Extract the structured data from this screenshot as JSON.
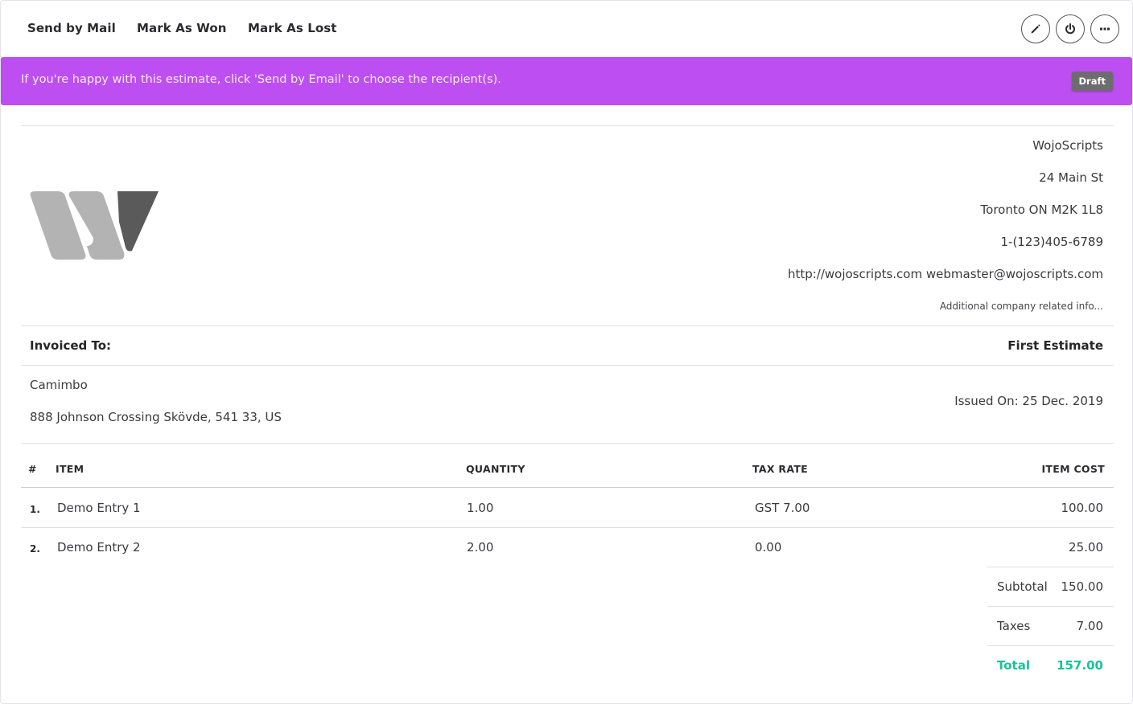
{
  "toolbar": {
    "send_mail": "Send by Mail",
    "mark_won": "Mark As Won",
    "mark_lost": "Mark As Lost",
    "icons": [
      "pencil-icon",
      "power-icon",
      "more-icon"
    ]
  },
  "banner": {
    "message": "If you're happy with this estimate, click 'Send by Email' to choose the recipient(s).",
    "status": "Draft",
    "color": "#bd4ff2"
  },
  "company": {
    "name": "WojoScripts",
    "street": "24 Main St",
    "city": "Toronto ON M2K 1L8",
    "phone": "1-(123)405-6789",
    "web_email": "http://wojoscripts.com webmaster@wojoscripts.com",
    "extra": "Additional company related info..."
  },
  "invoice": {
    "invoiced_to_label": "Invoiced To:",
    "title": "First Estimate",
    "client_name": "Camimbo",
    "client_address": "888 Johnson Crossing Skövde, 541 33, US",
    "issued": "Issued On: 25 Dec. 2019"
  },
  "table": {
    "headers": {
      "num": "#",
      "item": "ITEM",
      "quantity": "QUANTITY",
      "tax": "TAX RATE",
      "cost": "ITEM COST"
    },
    "rows": [
      {
        "num": "1.",
        "item": "Demo Entry 1",
        "quantity": "1.00",
        "tax": "GST 7.00",
        "cost": "100.00"
      },
      {
        "num": "2.",
        "item": "Demo Entry 2",
        "quantity": "2.00",
        "tax": "0.00",
        "cost": "25.00"
      }
    ]
  },
  "summary": {
    "subtotal_label": "Subtotal",
    "subtotal": "150.00",
    "taxes_label": "Taxes",
    "taxes": "7.00",
    "total_label": "Total",
    "total": "157.00",
    "total_color": "#19c39a"
  }
}
